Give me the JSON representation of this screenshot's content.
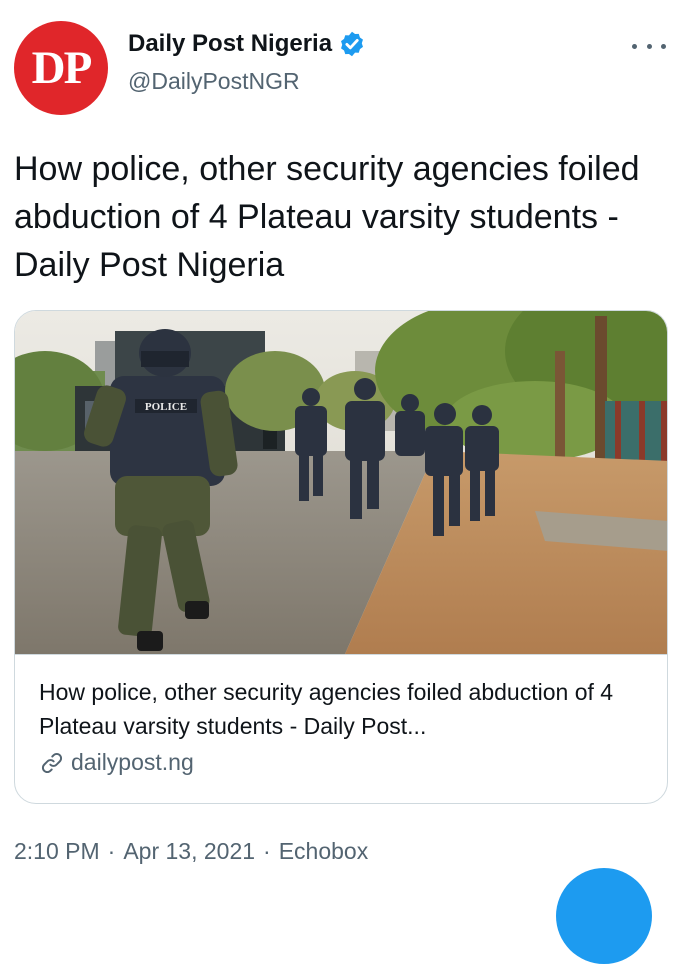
{
  "author": {
    "initials": "DP",
    "display_name": "Daily Post Nigeria",
    "handle": "@DailyPostNGR",
    "verified": true
  },
  "tweet": {
    "text": "How police, other security agencies foiled abduction of 4 Plateau varsity students - Daily Post Nigeria"
  },
  "card": {
    "image_alt": "Armed police officers running along a road",
    "title": "How police, other security agencies foiled abduction of 4 Plateau varsity students - Daily Post...",
    "domain": "dailypost.ng"
  },
  "meta": {
    "time": "2:10 PM",
    "date": "Apr 13, 2021",
    "source": "Echobox",
    "separator": "·"
  },
  "colors": {
    "brand_red": "#e0262a",
    "accent_blue": "#1d9bf0",
    "secondary_text": "#536471"
  }
}
